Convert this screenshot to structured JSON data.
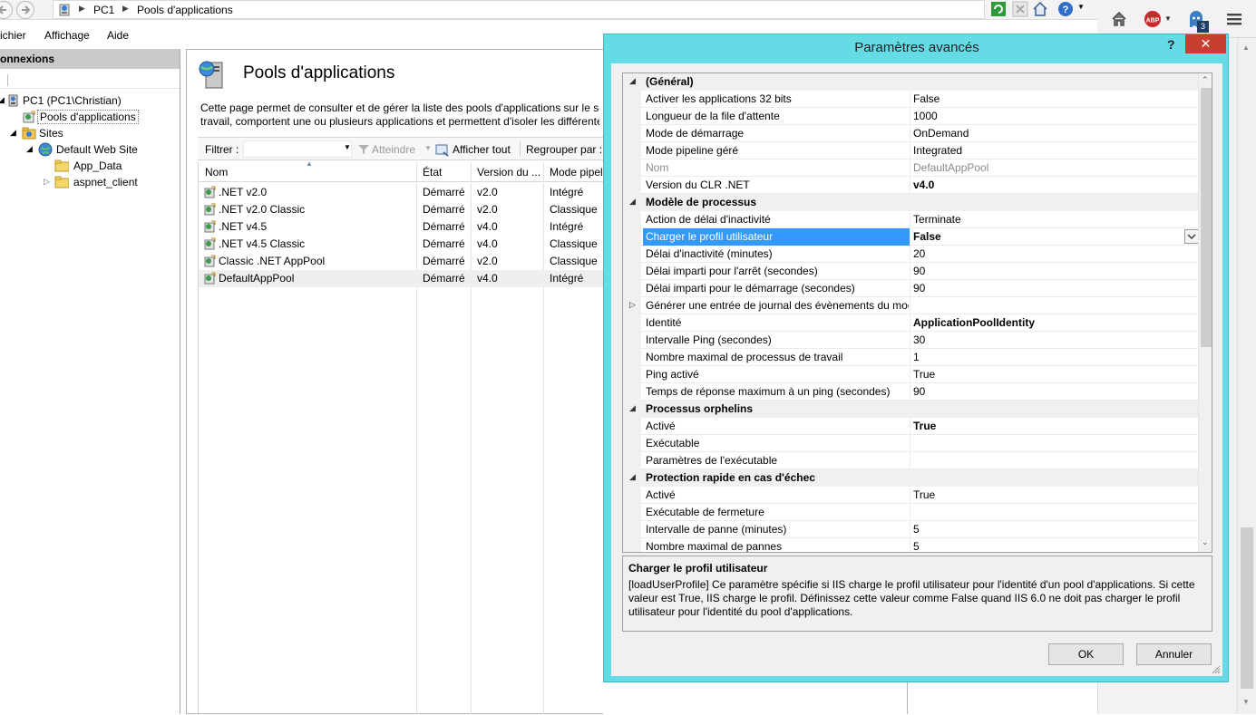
{
  "address": {
    "crumbs": [
      "PC1",
      "Pools d'applications"
    ]
  },
  "menu": [
    "ichier",
    "Affichage",
    "Aide"
  ],
  "connections": {
    "title": "onnexions",
    "tree": [
      {
        "label": "PC1 (PC1\\Christian)",
        "icon": "server-icon"
      },
      {
        "label": "Pools d'applications",
        "icon": "app-pool-icon"
      },
      {
        "label": "Sites",
        "icon": "sites-folder-icon"
      },
      {
        "label": "Default Web Site",
        "icon": "globe-icon"
      },
      {
        "label": "App_Data",
        "icon": "folder-icon"
      },
      {
        "label": "aspnet_client",
        "icon": "folder-icon"
      }
    ]
  },
  "center": {
    "title": "Pools d'applications",
    "desc_line1": "Cette page permet de consulter et de gérer la liste des pools d'applications sur le serv",
    "desc_line2": "travail, comportent une ou plusieurs applications et permettent d'isoler les différente",
    "filter_label": "Filtrer :",
    "goto_label": "Atteindre",
    "show_all_label": "Afficher tout",
    "group_label": "Regrouper par :",
    "columns": [
      "Nom",
      "État",
      "Version du ...",
      "Mode pipel"
    ],
    "rows": [
      {
        "name": ".NET v2.0",
        "state": "Démarré",
        "version": "v2.0",
        "mode": "Intégré"
      },
      {
        "name": ".NET v2.0 Classic",
        "state": "Démarré",
        "version": "v2.0",
        "mode": "Classique"
      },
      {
        "name": ".NET v4.5",
        "state": "Démarré",
        "version": "v4.0",
        "mode": "Intégré"
      },
      {
        "name": ".NET v4.5 Classic",
        "state": "Démarré",
        "version": "v4.0",
        "mode": "Classique"
      },
      {
        "name": "Classic .NET AppPool",
        "state": "Démarré",
        "version": "v2.0",
        "mode": "Classique"
      },
      {
        "name": "DefaultAppPool",
        "state": "Démarré",
        "version": "v4.0",
        "mode": "Intégré"
      }
    ]
  },
  "browser": {
    "badge_count": "3"
  },
  "dialog": {
    "title": "Paramètres avancés",
    "help": "?",
    "close": "✕",
    "ok_label": "OK",
    "cancel_label": "Annuler",
    "properties": [
      {
        "kind": "cat",
        "name": "(Général)",
        "toggle": "◢"
      },
      {
        "kind": "prop",
        "name": "Activer les applications 32 bits",
        "value": "False"
      },
      {
        "kind": "prop",
        "name": "Longueur de la file d'attente",
        "value": "1000"
      },
      {
        "kind": "prop",
        "name": "Mode de démarrage",
        "value": "OnDemand"
      },
      {
        "kind": "prop",
        "name": "Mode pipeline géré",
        "value": "Integrated"
      },
      {
        "kind": "dim",
        "name": "Nom",
        "value": "DefaultAppPool"
      },
      {
        "kind": "bold",
        "name": "Version du CLR .NET",
        "value": "v4.0"
      },
      {
        "kind": "cat",
        "name": "Modèle de processus",
        "toggle": "◢"
      },
      {
        "kind": "prop",
        "name": "Action de délai d'inactivité",
        "value": "Terminate"
      },
      {
        "kind": "hl",
        "name": "Charger le profil utilisateur",
        "value": "False"
      },
      {
        "kind": "prop",
        "name": "Délai d'inactivité (minutes)",
        "value": "20"
      },
      {
        "kind": "prop",
        "name": "Délai imparti pour l'arrêt (secondes)",
        "value": "90"
      },
      {
        "kind": "prop",
        "name": "Délai imparti pour le démarrage (secondes)",
        "value": "90"
      },
      {
        "kind": "sub",
        "name": "Générer une entrée de journal des évènements du mod",
        "value": "",
        "toggle": "▷"
      },
      {
        "kind": "bold",
        "name": "Identité",
        "value": "ApplicationPoolIdentity"
      },
      {
        "kind": "prop",
        "name": "Intervalle Ping (secondes)",
        "value": "30"
      },
      {
        "kind": "prop",
        "name": "Nombre maximal de processus de travail",
        "value": "1"
      },
      {
        "kind": "prop",
        "name": "Ping activé",
        "value": "True"
      },
      {
        "kind": "prop",
        "name": "Temps de réponse maximum à un ping (secondes)",
        "value": "90"
      },
      {
        "kind": "cat",
        "name": "Processus orphelins",
        "toggle": "◢"
      },
      {
        "kind": "bold",
        "name": "Activé",
        "value": "True"
      },
      {
        "kind": "prop",
        "name": "Exécutable",
        "value": ""
      },
      {
        "kind": "prop",
        "name": "Paramètres de l'exécutable",
        "value": ""
      },
      {
        "kind": "cat",
        "name": "Protection rapide en cas d'échec",
        "toggle": "◢"
      },
      {
        "kind": "prop",
        "name": "Activé",
        "value": "True"
      },
      {
        "kind": "prop",
        "name": "Exécutable de fermeture",
        "value": ""
      },
      {
        "kind": "prop",
        "name": "Intervalle de panne (minutes)",
        "value": "5"
      },
      {
        "kind": "prop",
        "name": "Nombre maximal de pannes",
        "value": "5"
      }
    ],
    "description": {
      "title": "Charger le profil utilisateur",
      "text": "[loadUserProfile] Ce paramètre spécifie si IIS charge le profil utilisateur pour l'identité d'un pool d'applications. Si cette valeur est True, IIS charge le profil. Définissez cette valeur comme False quand IIS 6.0 ne doit pas charger le profil utilisateur pour l'identité du pool d'applications."
    }
  }
}
